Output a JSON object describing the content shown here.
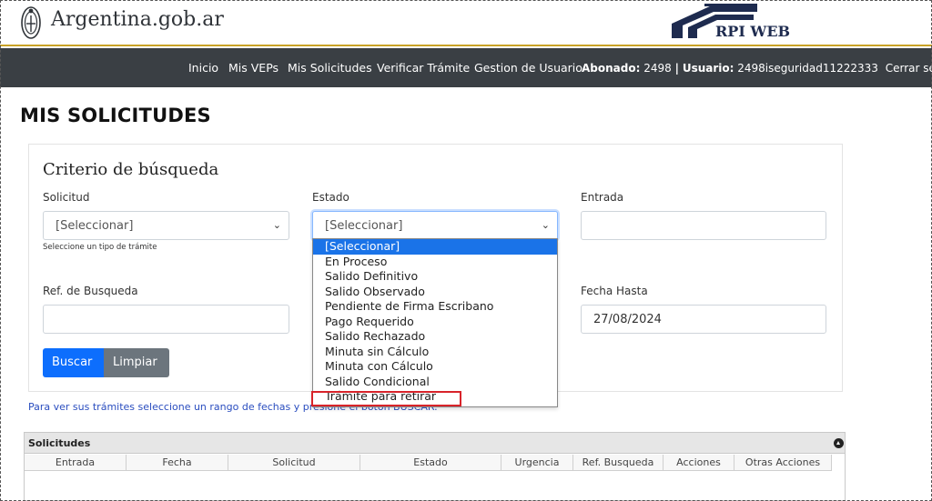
{
  "header": {
    "brand": "Argentina.gob.ar",
    "logo_text": "RPI WEB"
  },
  "nav": {
    "items": [
      "Inicio",
      "Mis VEPs",
      "Mis Solicitudes",
      "Verificar Trámite",
      "Gestion de Usuario"
    ],
    "abonado_label": "Abonado:",
    "abonado_value": "2498",
    "separator": "|",
    "usuario_label": "Usuario:",
    "usuario_value": "2498iseguridad11222333",
    "logout": "Cerrar sesión"
  },
  "page_title": "MIS SOLICITUDES",
  "search": {
    "title": "Criterio de búsqueda",
    "solicitud": {
      "label": "Solicitud",
      "value": "[Seleccionar]",
      "hint": "Seleccione un tipo de trámite"
    },
    "estado": {
      "label": "Estado",
      "value": "[Seleccionar]"
    },
    "entrada": {
      "label": "Entrada",
      "value": ""
    },
    "ref": {
      "label": "Ref. de Busqueda",
      "value": ""
    },
    "fecha_hasta": {
      "label": "Fecha Hasta",
      "value": "27/08/2024"
    },
    "buscar": "Buscar",
    "limpiar": "Limpiar"
  },
  "estado_dropdown": {
    "selected_index": 0,
    "options": [
      "[Seleccionar]",
      "En Proceso",
      "Salido Definitivo",
      "Salido Observado",
      "Pendiente de Firma Escribano",
      "Pago Requerido",
      "Salido Rechazado",
      "Minuta sin Cálculo",
      "Minuta con Cálculo",
      "Salido Condicional",
      "Trámite para retirar"
    ],
    "highlight_color": "#d8232a"
  },
  "info_text": "Para ver sus trámites seleccione un rango de fechas y presione el botón BUSCAR.",
  "table": {
    "title": "Solicitudes",
    "columns": [
      "Entrada",
      "Fecha",
      "Solicitud",
      "Estado",
      "Urgencia",
      "Ref. Busqueda",
      "Acciones",
      "Otras Acciones"
    ]
  },
  "colors": {
    "navbar": "#3a3f44",
    "primary": "#0d6efd",
    "secondary": "#6c757d",
    "accent": "#c9a227"
  }
}
